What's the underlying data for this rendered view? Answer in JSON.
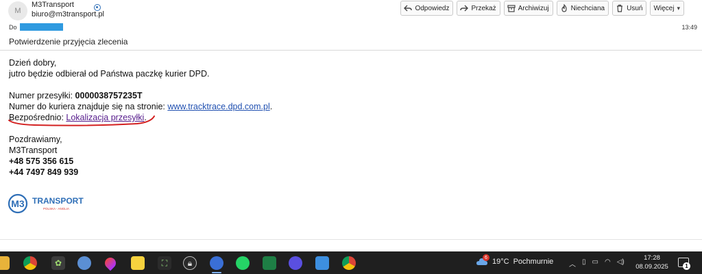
{
  "header": {
    "avatar_initial": "M",
    "sender_name": "M3Transport",
    "sender_email": "biuro@m3transport.pl",
    "to_label": "Do",
    "time": "13:49",
    "subject": "Potwierdzenie przyjęcia zlecenia"
  },
  "toolbar": {
    "reply": "Odpowiedz",
    "forward": "Przekaż",
    "archive": "Archiwizuj",
    "junk": "Niechciana",
    "delete": "Usuń",
    "more": "Więcej"
  },
  "message": {
    "greeting": "Dzień dobry,",
    "line2": "jutro będzie odbierał od Państwa paczkę kurier DPD.",
    "tracking_label": "Numer przesyłki: ",
    "tracking_number": "0000038757235T",
    "courier_label": "Numer do kuriera znajduje się na stronie: ",
    "courier_link": "www.tracktrace.dpd.com.pl",
    "courier_suffix": ".",
    "direct_label": "Bezpośrednio: ",
    "direct_link": "Lokalizacja przesyłki",
    "direct_suffix": ".",
    "closing": "Pozdrawiamy,",
    "company": "M3Transport",
    "phone_pl": "+48 575 356 615",
    "phone_uk": "+44 7497 849 939"
  },
  "logo": {
    "mark": "M3",
    "name": "TRANSPORT",
    "tagline": "POLSKA - ANGLIA",
    "color_blue": "#2f6fb7",
    "color_red": "#d9342b"
  },
  "taskbar": {
    "temperature": "19°C",
    "weather": "Pochmurnie",
    "weather_badge": "6",
    "clock_time": "17:28",
    "clock_date": "08.09.2025",
    "notification_count": "1",
    "apps": [
      "file-explorer-icon",
      "chrome-icon",
      "app-icon",
      "paint-icon",
      "drop-icon",
      "sticky-notes-icon",
      "snipping-icon",
      "lock-icon",
      "thunderbird-icon",
      "whatsapp-icon",
      "excel-icon",
      "messenger-icon",
      "photos-icon",
      "chrome-profile-icon"
    ]
  }
}
